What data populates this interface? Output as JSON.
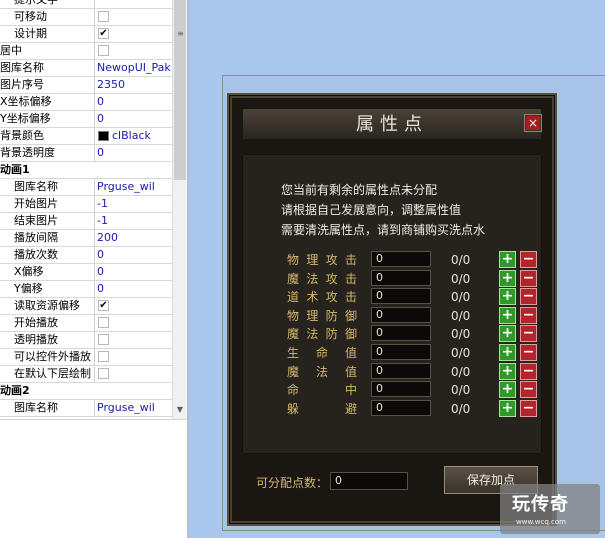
{
  "properties": {
    "rows": [
      {
        "name": "提示文字",
        "indent": 2,
        "kind": "text",
        "value": ""
      },
      {
        "name": "可移动",
        "indent": 2,
        "kind": "check",
        "checked": false
      },
      {
        "name": "设计期",
        "indent": 2,
        "kind": "check",
        "checked": true
      },
      {
        "name": "居中",
        "indent": 0,
        "kind": "check",
        "checked": false
      },
      {
        "name": "图库名称",
        "indent": 0,
        "kind": "text",
        "value": "NewopUI_Pak"
      },
      {
        "name": "图片序号",
        "indent": 0,
        "kind": "text",
        "value": "2350"
      },
      {
        "name": "X坐标偏移",
        "indent": 0,
        "kind": "text",
        "value": "0"
      },
      {
        "name": "Y坐标偏移",
        "indent": 0,
        "kind": "text",
        "value": "0"
      },
      {
        "name": "背景颜色",
        "indent": 0,
        "kind": "color",
        "value": "clBlack"
      },
      {
        "name": "背景透明度",
        "indent": 0,
        "kind": "text",
        "value": "0"
      },
      {
        "name": "动画1",
        "indent": 0,
        "kind": "category",
        "value": ""
      },
      {
        "name": "图库名称",
        "indent": 2,
        "kind": "text",
        "value": "Prguse_wil"
      },
      {
        "name": "开始图片",
        "indent": 2,
        "kind": "text",
        "value": "-1"
      },
      {
        "name": "结束图片",
        "indent": 2,
        "kind": "text",
        "value": "-1"
      },
      {
        "name": "播放间隔",
        "indent": 2,
        "kind": "text",
        "value": "200"
      },
      {
        "name": "播放次数",
        "indent": 2,
        "kind": "text",
        "value": "0"
      },
      {
        "name": "X偏移",
        "indent": 2,
        "kind": "text",
        "value": "0"
      },
      {
        "name": "Y偏移",
        "indent": 2,
        "kind": "text",
        "value": "0"
      },
      {
        "name": "读取资源偏移",
        "indent": 2,
        "kind": "check",
        "checked": true
      },
      {
        "name": "开始播放",
        "indent": 2,
        "kind": "check",
        "checked": false
      },
      {
        "name": "透明播放",
        "indent": 2,
        "kind": "check",
        "checked": false
      },
      {
        "name": "可以控件外播放",
        "indent": 2,
        "kind": "check",
        "checked": false
      },
      {
        "name": "在默认下层绘制",
        "indent": 2,
        "kind": "check",
        "checked": false
      },
      {
        "name": "动画2",
        "indent": 0,
        "kind": "category",
        "value": ""
      },
      {
        "name": "图库名称",
        "indent": 2,
        "kind": "text",
        "value": "Prguse_wil"
      }
    ]
  },
  "dialog": {
    "title": "属性点",
    "close_glyph": "×",
    "info": [
      "您当前有剩余的属性点未分配",
      "请根据自己发展意向，调整属性值",
      "需要清洗属性点，请到商铺购买洗点水"
    ],
    "attributes": [
      {
        "label": "物理攻击",
        "value": "0",
        "ratio": "0/0"
      },
      {
        "label": "魔法攻击",
        "value": "0",
        "ratio": "0/0"
      },
      {
        "label": "道术攻击",
        "value": "0",
        "ratio": "0/0"
      },
      {
        "label": "物理防御",
        "value": "0",
        "ratio": "0/0"
      },
      {
        "label": "魔法防御",
        "value": "0",
        "ratio": "0/0"
      },
      {
        "label": "生命值",
        "value": "0",
        "ratio": "0/0"
      },
      {
        "label": "魔法值",
        "value": "0",
        "ratio": "0/0"
      },
      {
        "label": "命中",
        "value": "0",
        "ratio": "0/0"
      },
      {
        "label": "躲避",
        "value": "0",
        "ratio": "0/0"
      }
    ],
    "plus_glyph": "+",
    "minus_glyph": "−",
    "points_label": "可分配点数：",
    "points_value": "0",
    "save_label": "保存加点"
  },
  "watermark": {
    "logo": "玩传奇",
    "url": "www.wcq.com"
  },
  "colors": {
    "canvas_bg": "#a9c7ec",
    "dialog_bg": "#1a1612",
    "label_gold": "#d3b86b",
    "plus_green": "#2f9a2a",
    "minus_red": "#b1262b"
  }
}
